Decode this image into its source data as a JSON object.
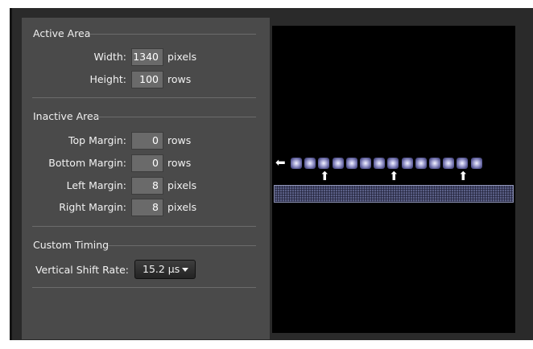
{
  "active_area": {
    "title": "Active Area",
    "width_label": "Width:",
    "width_value": "1340",
    "width_unit": "pixels",
    "height_label": "Height:",
    "height_value": "100",
    "height_unit": "rows"
  },
  "inactive_area": {
    "title": "Inactive Area",
    "top_label": "Top Margin:",
    "top_value": "0",
    "top_unit": "rows",
    "bottom_label": "Bottom Margin:",
    "bottom_value": "0",
    "bottom_unit": "rows",
    "left_label": "Left Margin:",
    "left_value": "8",
    "left_unit": "pixels",
    "right_label": "Right Margin:",
    "right_value": "8",
    "right_unit": "pixels"
  },
  "custom_timing": {
    "title": "Custom Timing",
    "shift_rate_label": "Vertical Shift Rate:",
    "shift_rate_value": "15.2 µs"
  },
  "preview": {
    "serial_register_pixel_count": 14,
    "shift_arrow_count": 3,
    "readout_arrow_icon": "arrow-left-icon",
    "shift_arrow_icon": "arrow-up-icon",
    "pixel_color": "#9a9ad0",
    "register_color": "#5a5f86"
  },
  "colors": {
    "panel_bg": "#4a4a4a",
    "field_bg": "#6a6a6a",
    "preview_bg": "#000000"
  }
}
